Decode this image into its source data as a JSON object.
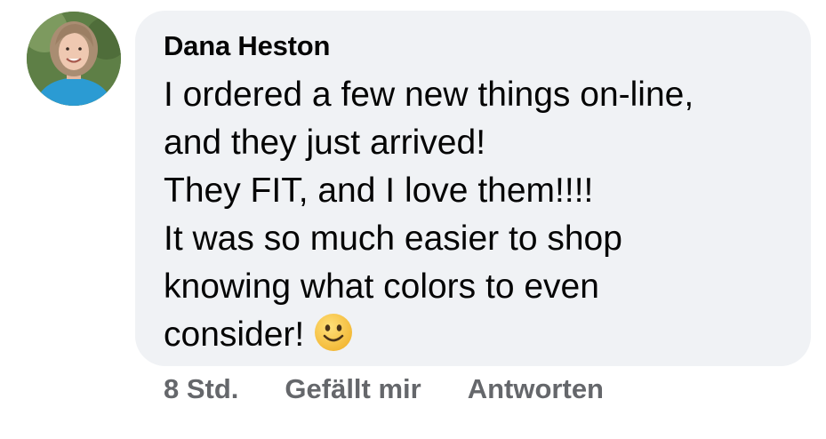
{
  "comment": {
    "author": "Dana Heston",
    "lines": [
      "I ordered a few new things on-line,",
      "and they just arrived!",
      "They FIT, and I love them!!!!",
      "It was so much easier to shop",
      "knowing what colors to even",
      "consider!"
    ],
    "emoji": "slightly-smiling-face",
    "avatar_icon": "profile-photo"
  },
  "actions": {
    "time": "8 Std.",
    "like_label": "Gefällt mir",
    "reply_label": "Antworten"
  },
  "colors": {
    "bubble": "#f0f2f5",
    "text": "#050505",
    "secondary_text": "#65676b",
    "emoji_face": "#f7c64a"
  }
}
